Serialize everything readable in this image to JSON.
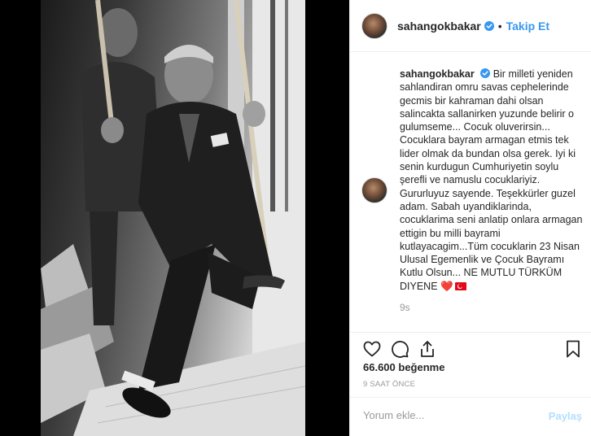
{
  "header": {
    "username": "sahangokbakar",
    "verified_icon": "verified-badge-icon",
    "separator": "•",
    "follow_label": "Takip Et",
    "follow_color": "#3897f0"
  },
  "caption": {
    "username": "sahangokbakar",
    "text": "Bir milleti yeniden sahlandiran omru savas cephelerinde gecmis bir kahraman dahi olsan salincakta sallanirken yuzunde belirir o gulumseme... Cocuk oluverirsin... Cocuklara bayram armagan etmis tek lider olmak da bundan olsa gerek. Iyi ki senin kurdugun Cumhuriyetin soylu şerefli ve namuslu cocuklariyiz. Gururluyuz sayende. Teşekkürler guzel adam. Sabah uyandiklarinda, cocuklarima seni anlatip onlara armagan ettigin bu milli bayrami kutlayacagim...Tüm cocuklarin 23 Nisan Ulusal Egemenlik ve Çocuk Bayramı Kutlu Olsun... NE MUTLU TÜRKÜM DIYENE",
    "emojis": [
      "heart-emoji",
      "turkey-flag-emoji"
    ],
    "heart_symbol": "❤️",
    "time_ago": "9s"
  },
  "actions": {
    "icons": [
      "heart-icon",
      "comment-icon",
      "share-icon",
      "bookmark-icon"
    ],
    "likes": "66.600 beğenme",
    "date": "9 SAAT ÖNCE"
  },
  "comment_box": {
    "placeholder": "Yorum ekle...",
    "post_label": "Paylaş",
    "post_color": "#b2dffc"
  },
  "media": {
    "description_icon": "black-and-white-photo"
  }
}
